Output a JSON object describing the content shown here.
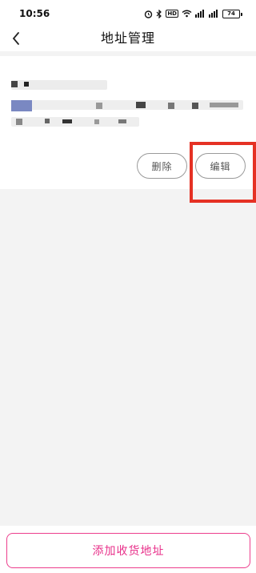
{
  "status_bar": {
    "time": "10:56",
    "icons": [
      "alarm-icon",
      "bluetooth-icon",
      "hd-icon",
      "wifi-icon",
      "signal-icon",
      "signal-icon"
    ],
    "hd_label": "HD",
    "battery": "74"
  },
  "nav": {
    "title": "地址管理"
  },
  "address": {
    "delete_label": "删除",
    "edit_label": "编辑"
  },
  "footer": {
    "add_label": "添加收货地址"
  },
  "colors": {
    "accent": "#e8308a",
    "highlight": "#e53124",
    "background": "#f3f3f3"
  }
}
